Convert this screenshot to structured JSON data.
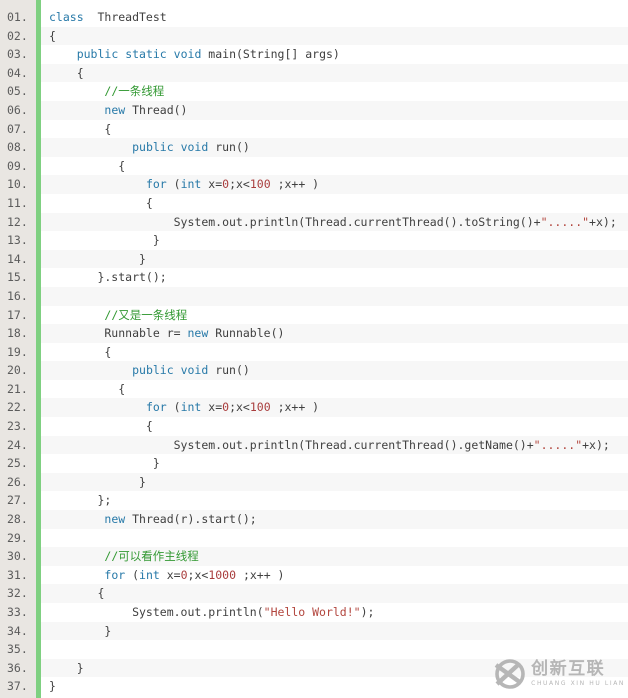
{
  "theme": {
    "kw": "#2779a8",
    "pl": "#404040",
    "cm": "#339933",
    "st": "#b2453d",
    "nu": "#a93d3d",
    "ln": "#5c5c5c",
    "gutterbg": "#e9e6e2",
    "bar": "#7fd081",
    "zebra": "#f7f7f7",
    "wm": "#b6b6b6"
  },
  "watermark": {
    "brand": "创新互联",
    "sub": "CHUANG XIN HU LIAN"
  },
  "code": {
    "lines": [
      {
        "num": "01.",
        "tokens": [
          [
            "kw",
            "class"
          ],
          [
            "pl",
            "  ThreadTest"
          ]
        ]
      },
      {
        "num": "02.",
        "tokens": [
          [
            "pl",
            "{"
          ]
        ]
      },
      {
        "num": "03.",
        "tokens": [
          [
            "pl",
            "    "
          ],
          [
            "kw",
            "public"
          ],
          [
            "pl",
            " "
          ],
          [
            "kw",
            "static"
          ],
          [
            "pl",
            " "
          ],
          [
            "kw",
            "void"
          ],
          [
            "pl",
            " main(String[] args)"
          ]
        ]
      },
      {
        "num": "04.",
        "tokens": [
          [
            "pl",
            "    {"
          ]
        ]
      },
      {
        "num": "05.",
        "tokens": [
          [
            "pl",
            "        "
          ],
          [
            "cm",
            "//一条线程"
          ]
        ]
      },
      {
        "num": "06.",
        "tokens": [
          [
            "pl",
            "        "
          ],
          [
            "kw",
            "new"
          ],
          [
            "pl",
            " Thread()"
          ]
        ]
      },
      {
        "num": "07.",
        "tokens": [
          [
            "pl",
            "        {"
          ]
        ]
      },
      {
        "num": "08.",
        "tokens": [
          [
            "pl",
            "            "
          ],
          [
            "kw",
            "public"
          ],
          [
            "pl",
            " "
          ],
          [
            "kw",
            "void"
          ],
          [
            "pl",
            " run()"
          ]
        ]
      },
      {
        "num": "09.",
        "tokens": [
          [
            "pl",
            "          {"
          ]
        ]
      },
      {
        "num": "10.",
        "tokens": [
          [
            "pl",
            "              "
          ],
          [
            "kw",
            "for"
          ],
          [
            "pl",
            " ("
          ],
          [
            "kw",
            "int"
          ],
          [
            "pl",
            " x="
          ],
          [
            "nu",
            "0"
          ],
          [
            "pl",
            ";x<"
          ],
          [
            "nu",
            "100"
          ],
          [
            "pl",
            " ;x++ )"
          ]
        ]
      },
      {
        "num": "11.",
        "tokens": [
          [
            "pl",
            "              {"
          ]
        ]
      },
      {
        "num": "12.",
        "tokens": [
          [
            "pl",
            "                  System.out.println(Thread.currentThread().toString()+"
          ],
          [
            "st",
            "\".....\""
          ],
          [
            "pl",
            "+x);"
          ]
        ]
      },
      {
        "num": "13.",
        "tokens": [
          [
            "pl",
            "               }"
          ]
        ]
      },
      {
        "num": "14.",
        "tokens": [
          [
            "pl",
            "             }"
          ]
        ]
      },
      {
        "num": "15.",
        "tokens": [
          [
            "pl",
            "       }.start();"
          ]
        ]
      },
      {
        "num": "16.",
        "tokens": []
      },
      {
        "num": "17.",
        "tokens": [
          [
            "pl",
            "        "
          ],
          [
            "cm",
            "//又是一条线程"
          ]
        ]
      },
      {
        "num": "18.",
        "tokens": [
          [
            "pl",
            "        Runnable r= "
          ],
          [
            "kw",
            "new"
          ],
          [
            "pl",
            " Runnable()"
          ]
        ]
      },
      {
        "num": "19.",
        "tokens": [
          [
            "pl",
            "        {"
          ]
        ]
      },
      {
        "num": "20.",
        "tokens": [
          [
            "pl",
            "            "
          ],
          [
            "kw",
            "public"
          ],
          [
            "pl",
            " "
          ],
          [
            "kw",
            "void"
          ],
          [
            "pl",
            " run()"
          ]
        ]
      },
      {
        "num": "21.",
        "tokens": [
          [
            "pl",
            "          {"
          ]
        ]
      },
      {
        "num": "22.",
        "tokens": [
          [
            "pl",
            "              "
          ],
          [
            "kw",
            "for"
          ],
          [
            "pl",
            " ("
          ],
          [
            "kw",
            "int"
          ],
          [
            "pl",
            " x="
          ],
          [
            "nu",
            "0"
          ],
          [
            "pl",
            ";x<"
          ],
          [
            "nu",
            "100"
          ],
          [
            "pl",
            " ;x++ )"
          ]
        ]
      },
      {
        "num": "23.",
        "tokens": [
          [
            "pl",
            "              {"
          ]
        ]
      },
      {
        "num": "24.",
        "tokens": [
          [
            "pl",
            "                  System.out.println(Thread.currentThread().getName()+"
          ],
          [
            "st",
            "\".....\""
          ],
          [
            "pl",
            "+x);"
          ]
        ]
      },
      {
        "num": "25.",
        "tokens": [
          [
            "pl",
            "               }"
          ]
        ]
      },
      {
        "num": "26.",
        "tokens": [
          [
            "pl",
            "             }"
          ]
        ]
      },
      {
        "num": "27.",
        "tokens": [
          [
            "pl",
            "       };"
          ]
        ]
      },
      {
        "num": "28.",
        "tokens": [
          [
            "pl",
            "        "
          ],
          [
            "kw",
            "new"
          ],
          [
            "pl",
            " Thread(r).start();"
          ]
        ]
      },
      {
        "num": "29.",
        "tokens": []
      },
      {
        "num": "30.",
        "tokens": [
          [
            "pl",
            "        "
          ],
          [
            "cm",
            "//可以看作主线程"
          ]
        ]
      },
      {
        "num": "31.",
        "tokens": [
          [
            "pl",
            "        "
          ],
          [
            "kw",
            "for"
          ],
          [
            "pl",
            " ("
          ],
          [
            "kw",
            "int"
          ],
          [
            "pl",
            " x="
          ],
          [
            "nu",
            "0"
          ],
          [
            "pl",
            ";x<"
          ],
          [
            "nu",
            "1000"
          ],
          [
            "pl",
            " ;x++ )"
          ]
        ]
      },
      {
        "num": "32.",
        "tokens": [
          [
            "pl",
            "       {"
          ]
        ]
      },
      {
        "num": "33.",
        "tokens": [
          [
            "pl",
            "            System.out.println("
          ],
          [
            "st",
            "\"Hello World!\""
          ],
          [
            "pl",
            ");"
          ]
        ]
      },
      {
        "num": "34.",
        "tokens": [
          [
            "pl",
            "        }"
          ]
        ]
      },
      {
        "num": "35.",
        "tokens": []
      },
      {
        "num": "36.",
        "tokens": [
          [
            "pl",
            "    }"
          ]
        ]
      },
      {
        "num": "37.",
        "tokens": [
          [
            "pl",
            "}"
          ]
        ]
      }
    ]
  }
}
